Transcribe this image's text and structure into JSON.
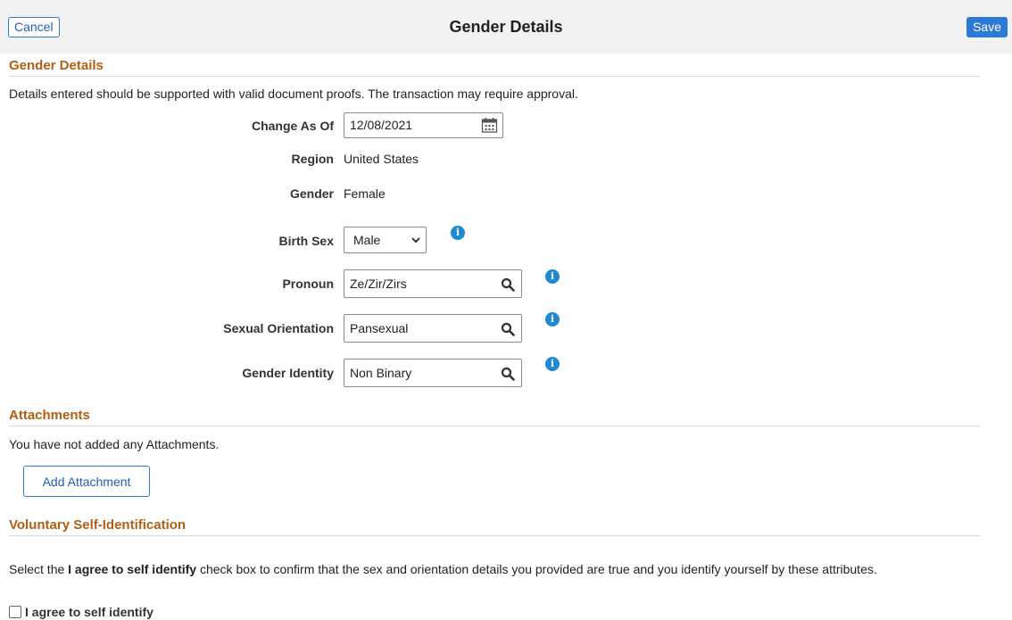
{
  "header": {
    "cancel_label": "Cancel",
    "title": "Gender Details",
    "save_label": "Save"
  },
  "gender_section": {
    "title": "Gender Details",
    "instructions": "Details entered should be supported with valid document proofs. The transaction may require approval.",
    "change_as_of": {
      "label": "Change As Of",
      "value": "12/08/2021",
      "icon": "calendar-icon"
    },
    "region": {
      "label": "Region",
      "value": "United States"
    },
    "gender": {
      "label": "Gender",
      "value": "Female"
    },
    "birth_sex": {
      "label": "Birth Sex",
      "selected": "Male",
      "icon": "info-icon"
    },
    "pronoun": {
      "label": "Pronoun",
      "value": "Ze/Zir/Zirs",
      "icon": "search-icon"
    },
    "sexual_orientation": {
      "label": "Sexual Orientation",
      "value": "Pansexual",
      "icon": "search-icon"
    },
    "gender_identity": {
      "label": "Gender Identity",
      "value": "Non Binary",
      "icon": "search-icon"
    },
    "info_glyph": "i"
  },
  "attachments": {
    "title": "Attachments",
    "empty_text": "You have not added any Attachments.",
    "add_button": "Add Attachment"
  },
  "self_id": {
    "title": "Voluntary Self-Identification",
    "text_before": "Select the ",
    "text_bold": "I agree to self identify",
    "text_after": " check box to confirm that the sex and orientation details you provided are true and you identify yourself by these attributes.",
    "checkbox_label": "I agree to self identify",
    "checked": false
  },
  "colors": {
    "accent": "#2d7ad6",
    "section_title": "#b25e14",
    "info_icon": "#1d8ad2",
    "header_bg": "#f2f2f2"
  }
}
